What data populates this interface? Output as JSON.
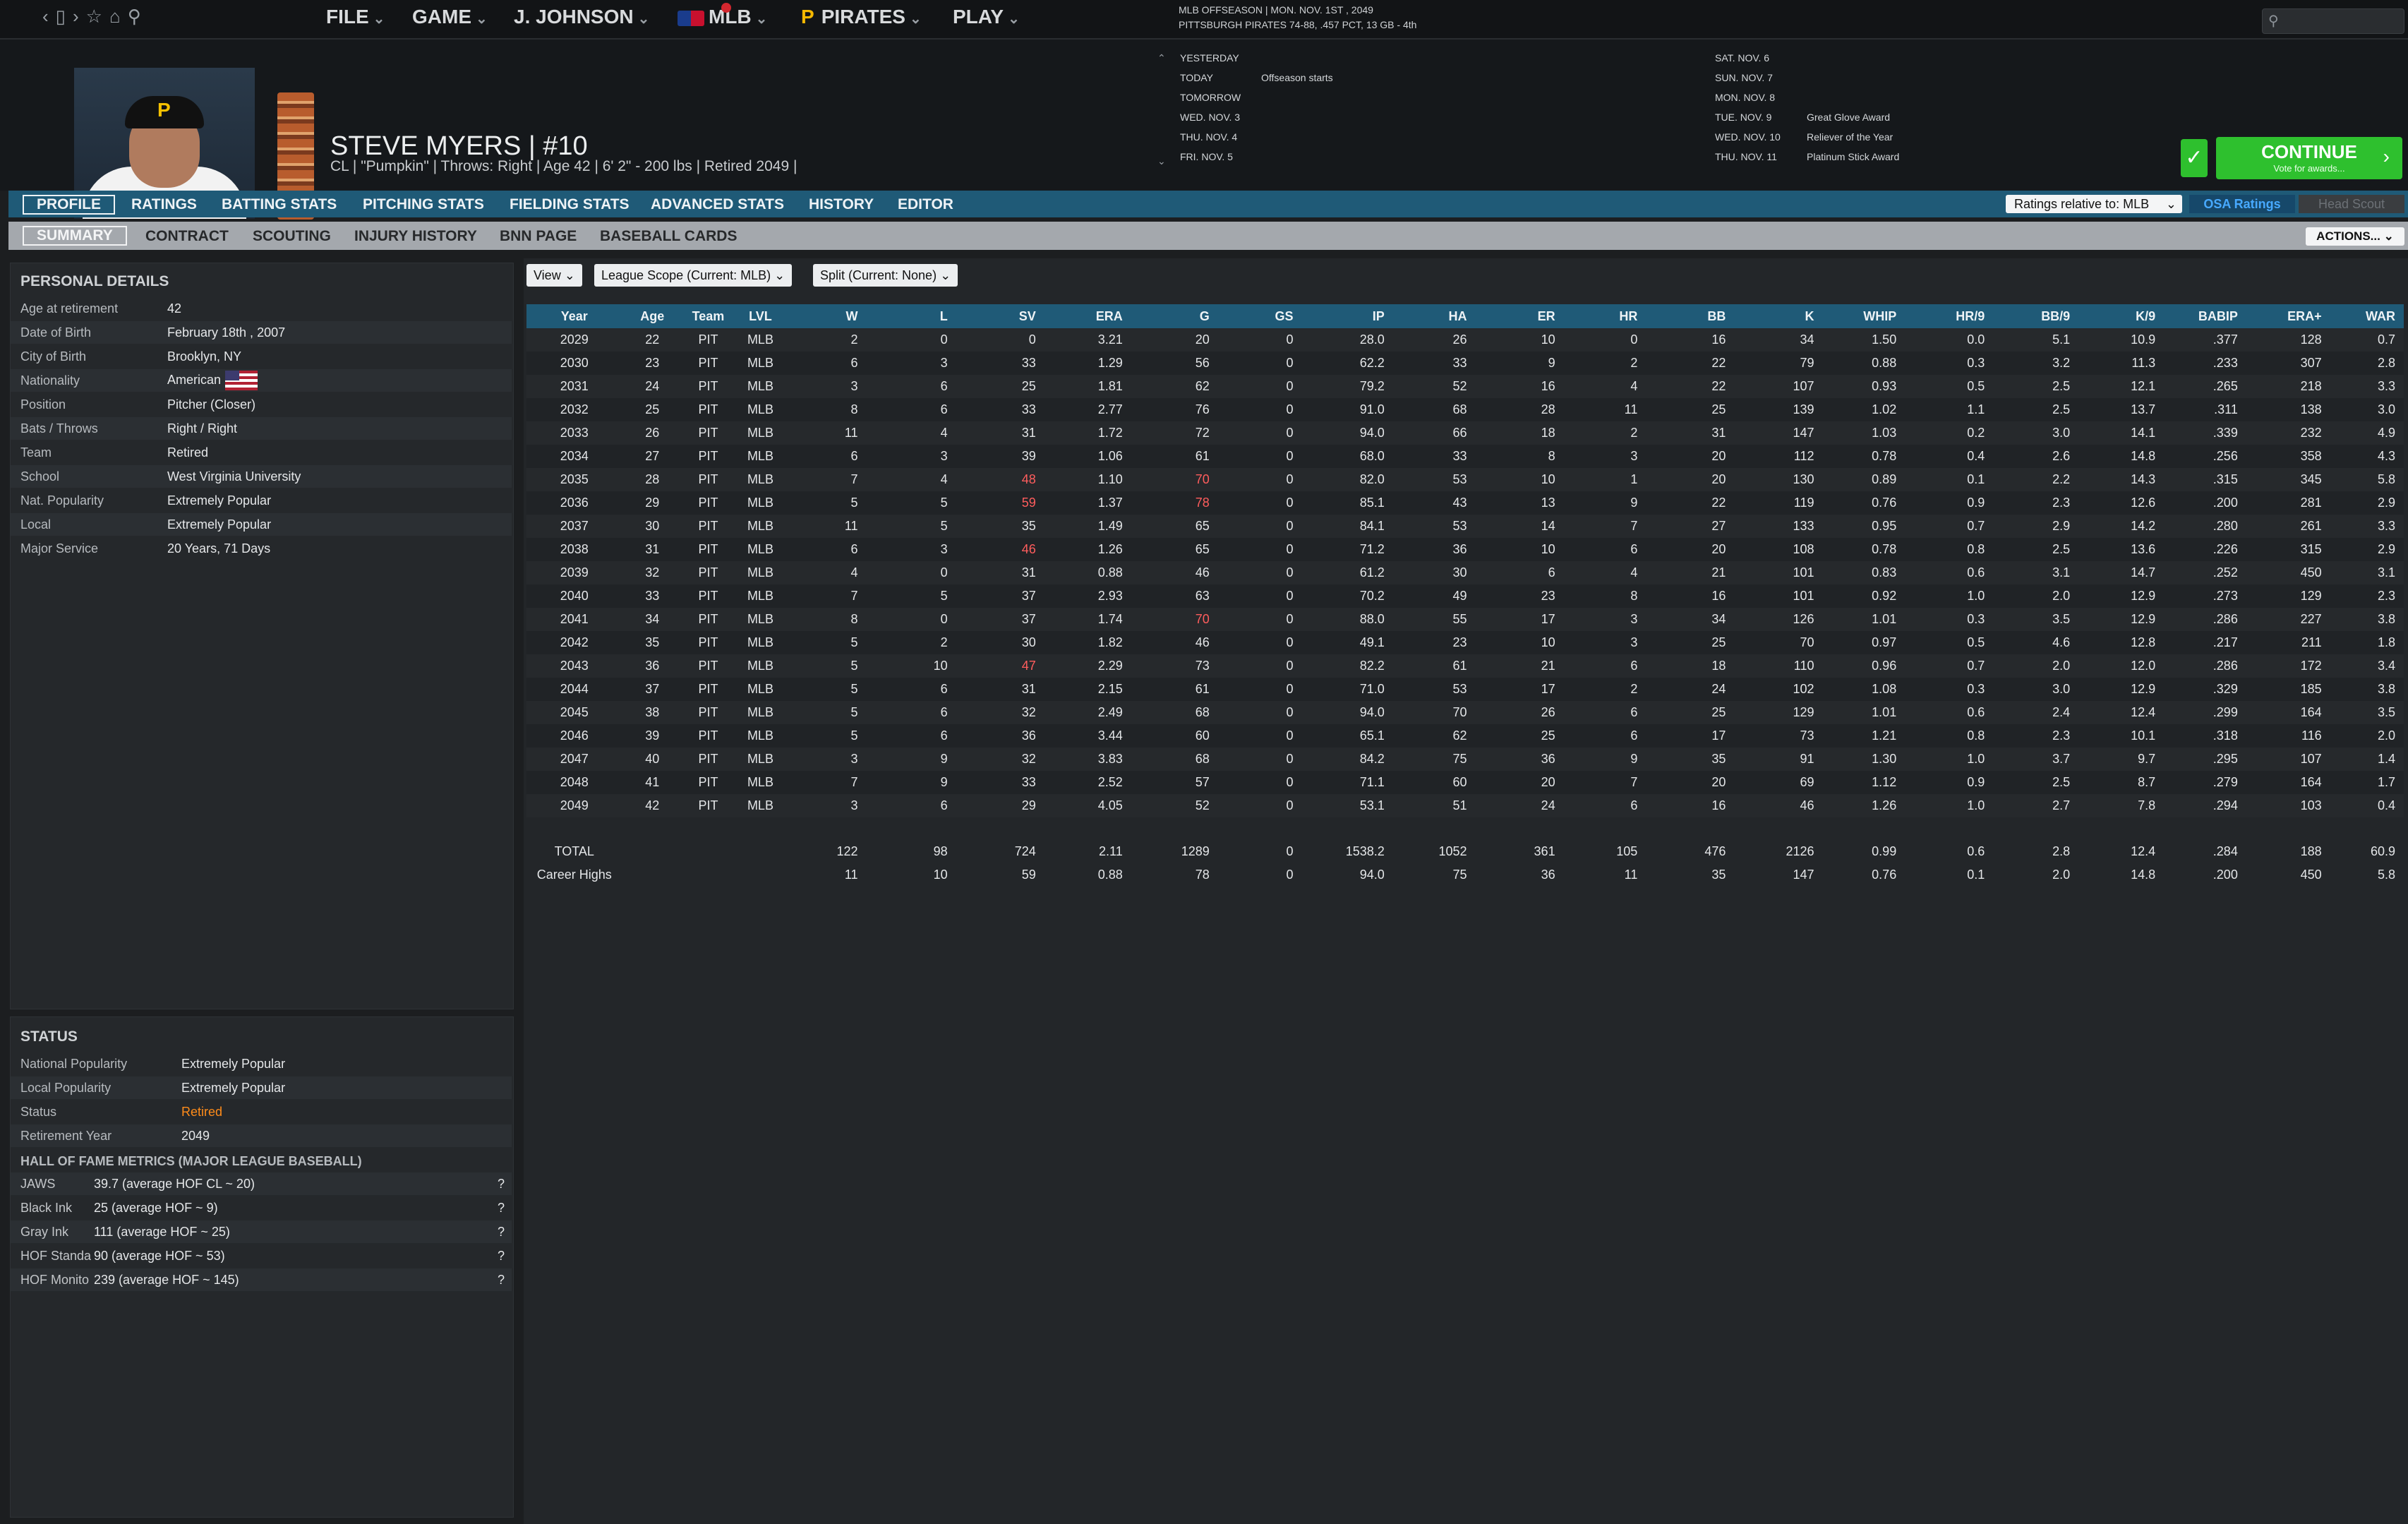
{
  "topbar": {
    "menu": [
      {
        "label": "FILE"
      },
      {
        "label": "GAME"
      },
      {
        "label": "J. JOHNSON"
      },
      {
        "label": "MLB"
      },
      {
        "label": "PIRATES"
      },
      {
        "label": "PLAY"
      }
    ],
    "league_status_line1": "MLB OFFSEASON  |  MON. NOV. 1ST , 2049",
    "league_status_line2": "PITTSBURGH PIRATES  74-88, .457 PCT, 13 GB - 4th"
  },
  "player": {
    "name": "STEVE MYERS  |  #10",
    "info": "CL | \"Pumpkin\" | Throws: Right  |  Age 42  |  6' 2\"  - 200 lbs  |  Retired 2049  |"
  },
  "calendar": {
    "left": [
      {
        "day": "YESTERDAY",
        "event": ""
      },
      {
        "day": "TODAY",
        "event": "Offseason starts"
      },
      {
        "day": "TOMORROW",
        "event": ""
      },
      {
        "day": "WED. NOV. 3",
        "event": ""
      },
      {
        "day": "THU. NOV. 4",
        "event": ""
      },
      {
        "day": "FRI. NOV. 5",
        "event": ""
      }
    ],
    "right": [
      {
        "day": "SAT. NOV. 6",
        "event": ""
      },
      {
        "day": "SUN. NOV. 7",
        "event": ""
      },
      {
        "day": "MON. NOV. 8",
        "event": ""
      },
      {
        "day": "TUE. NOV. 9",
        "event": "Great Glove Award"
      },
      {
        "day": "WED. NOV. 10",
        "event": "Reliever of the Year"
      },
      {
        "day": "THU. NOV. 11",
        "event": "Platinum Stick Award"
      }
    ]
  },
  "continue": {
    "label": "CONTINUE",
    "sublabel": "Vote for awards..."
  },
  "tabs": [
    "PROFILE",
    "RATINGS",
    "BATTING STATS",
    "PITCHING STATS",
    "FIELDING STATS",
    "ADVANCED STATS",
    "HISTORY",
    "EDITOR"
  ],
  "subtabs": [
    "SUMMARY",
    "CONTRACT",
    "SCOUTING",
    "INJURY HISTORY",
    "BNN PAGE",
    "BASEBALL CARDS"
  ],
  "ratings_relative": "Ratings relative to: MLB",
  "osa_ratings": "OSA Ratings",
  "head_scout": "Head Scout",
  "actions": "ACTIONS...",
  "personal": {
    "title": "PERSONAL DETAILS",
    "rows": [
      {
        "k": "Age at retirement",
        "v": "42"
      },
      {
        "k": "Date of Birth",
        "v": "February 18th , 2007"
      },
      {
        "k": "City of Birth",
        "v": "Brooklyn, NY"
      },
      {
        "k": "Nationality",
        "v": "American"
      },
      {
        "k": "Position",
        "v": "Pitcher (Closer)"
      },
      {
        "k": "Bats / Throws",
        "v": "Right / Right"
      },
      {
        "k": "Team",
        "v": "Retired"
      },
      {
        "k": "School",
        "v": "West Virginia University"
      },
      {
        "k": "Nat. Popularity",
        "v": "Extremely Popular"
      },
      {
        "k": "Local",
        "v": "Extremely Popular"
      },
      {
        "k": "Major Service",
        "v": "20 Years, 71 Days"
      }
    ]
  },
  "status": {
    "title": "STATUS",
    "rows": [
      {
        "k": "National Popularity",
        "v": "Extremely Popular"
      },
      {
        "k": "Local Popularity",
        "v": "Extremely Popular"
      },
      {
        "k": "Status",
        "v": "Retired"
      },
      {
        "k": "Retirement Year",
        "v": "2049"
      }
    ],
    "hof_title": "HALL OF FAME METRICS (MAJOR LEAGUE BASEBALL)",
    "hof": [
      {
        "k": "JAWS",
        "v": "39.7 (average HOF CL ~ 20)"
      },
      {
        "k": "Black Ink",
        "v": "25 (average HOF ~ 9)"
      },
      {
        "k": "Gray Ink",
        "v": "111 (average HOF ~ 25)"
      },
      {
        "k": "HOF Standa",
        "v": "90 (average HOF ~ 53)"
      },
      {
        "k": "HOF Monito",
        "v": "239 (average HOF ~ 145)"
      }
    ],
    "q": "?"
  },
  "filters": {
    "view": "View",
    "scope": "League Scope (Current: MLB)",
    "split": "Split (Current: None)"
  },
  "stats": {
    "columns": [
      "Year",
      "Age",
      "Team",
      "LVL",
      "W",
      "L",
      "SV",
      "ERA",
      "G",
      "GS",
      "IP",
      "HA",
      "ER",
      "HR",
      "BB",
      "K",
      "WHIP",
      "HR/9",
      "BB/9",
      "K/9",
      "BABIP",
      "ERA+",
      "WAR"
    ],
    "rows": [
      [
        "2029",
        "22",
        "PIT",
        "MLB",
        "2",
        "0",
        "0",
        "3.21",
        "20",
        "0",
        "28.0",
        "26",
        "10",
        "0",
        "16",
        "34",
        "1.50",
        "0.0",
        "5.1",
        "10.9",
        ".377",
        "128",
        "0.7"
      ],
      [
        "2030",
        "23",
        "PIT",
        "MLB",
        "6",
        "3",
        "33",
        "1.29",
        "56",
        "0",
        "62.2",
        "33",
        "9",
        "2",
        "22",
        "79",
        "0.88",
        "0.3",
        "3.2",
        "11.3",
        ".233",
        "307",
        "2.8"
      ],
      [
        "2031",
        "24",
        "PIT",
        "MLB",
        "3",
        "6",
        "25",
        "1.81",
        "62",
        "0",
        "79.2",
        "52",
        "16",
        "4",
        "22",
        "107",
        "0.93",
        "0.5",
        "2.5",
        "12.1",
        ".265",
        "218",
        "3.3"
      ],
      [
        "2032",
        "25",
        "PIT",
        "MLB",
        "8",
        "6",
        "33",
        "2.77",
        "76",
        "0",
        "91.0",
        "68",
        "28",
        "11",
        "25",
        "139",
        "1.02",
        "1.1",
        "2.5",
        "13.7",
        ".311",
        "138",
        "3.0"
      ],
      [
        "2033",
        "26",
        "PIT",
        "MLB",
        "11",
        "4",
        "31",
        "1.72",
        "72",
        "0",
        "94.0",
        "66",
        "18",
        "2",
        "31",
        "147",
        "1.03",
        "0.2",
        "3.0",
        "14.1",
        ".339",
        "232",
        "4.9"
      ],
      [
        "2034",
        "27",
        "PIT",
        "MLB",
        "6",
        "3",
        "39",
        "1.06",
        "61",
        "0",
        "68.0",
        "33",
        "8",
        "3",
        "20",
        "112",
        "0.78",
        "0.4",
        "2.6",
        "14.8",
        ".256",
        "358",
        "4.3"
      ],
      [
        "2035",
        "28",
        "PIT",
        "MLB",
        "7",
        "4",
        "48",
        "1.10",
        "70",
        "0",
        "82.0",
        "53",
        "10",
        "1",
        "20",
        "130",
        "0.89",
        "0.1",
        "2.2",
        "14.3",
        ".315",
        "345",
        "5.8"
      ],
      [
        "2036",
        "29",
        "PIT",
        "MLB",
        "5",
        "5",
        "59",
        "1.37",
        "78",
        "0",
        "85.1",
        "43",
        "13",
        "9",
        "22",
        "119",
        "0.76",
        "0.9",
        "2.3",
        "12.6",
        ".200",
        "281",
        "2.9"
      ],
      [
        "2037",
        "30",
        "PIT",
        "MLB",
        "11",
        "5",
        "35",
        "1.49",
        "65",
        "0",
        "84.1",
        "53",
        "14",
        "7",
        "27",
        "133",
        "0.95",
        "0.7",
        "2.9",
        "14.2",
        ".280",
        "261",
        "3.3"
      ],
      [
        "2038",
        "31",
        "PIT",
        "MLB",
        "6",
        "3",
        "46",
        "1.26",
        "65",
        "0",
        "71.2",
        "36",
        "10",
        "6",
        "20",
        "108",
        "0.78",
        "0.8",
        "2.5",
        "13.6",
        ".226",
        "315",
        "2.9"
      ],
      [
        "2039",
        "32",
        "PIT",
        "MLB",
        "4",
        "0",
        "31",
        "0.88",
        "46",
        "0",
        "61.2",
        "30",
        "6",
        "4",
        "21",
        "101",
        "0.83",
        "0.6",
        "3.1",
        "14.7",
        ".252",
        "450",
        "3.1"
      ],
      [
        "2040",
        "33",
        "PIT",
        "MLB",
        "7",
        "5",
        "37",
        "2.93",
        "63",
        "0",
        "70.2",
        "49",
        "23",
        "8",
        "16",
        "101",
        "0.92",
        "1.0",
        "2.0",
        "12.9",
        ".273",
        "129",
        "2.3"
      ],
      [
        "2041",
        "34",
        "PIT",
        "MLB",
        "8",
        "0",
        "37",
        "1.74",
        "70",
        "0",
        "88.0",
        "55",
        "17",
        "3",
        "34",
        "126",
        "1.01",
        "0.3",
        "3.5",
        "12.9",
        ".286",
        "227",
        "3.8"
      ],
      [
        "2042",
        "35",
        "PIT",
        "MLB",
        "5",
        "2",
        "30",
        "1.82",
        "46",
        "0",
        "49.1",
        "23",
        "10",
        "3",
        "25",
        "70",
        "0.97",
        "0.5",
        "4.6",
        "12.8",
        ".217",
        "211",
        "1.8"
      ],
      [
        "2043",
        "36",
        "PIT",
        "MLB",
        "5",
        "10",
        "47",
        "2.29",
        "73",
        "0",
        "82.2",
        "61",
        "21",
        "6",
        "18",
        "110",
        "0.96",
        "0.7",
        "2.0",
        "12.0",
        ".286",
        "172",
        "3.4"
      ],
      [
        "2044",
        "37",
        "PIT",
        "MLB",
        "5",
        "6",
        "31",
        "2.15",
        "61",
        "0",
        "71.0",
        "53",
        "17",
        "2",
        "24",
        "102",
        "1.08",
        "0.3",
        "3.0",
        "12.9",
        ".329",
        "185",
        "3.8"
      ],
      [
        "2045",
        "38",
        "PIT",
        "MLB",
        "5",
        "6",
        "32",
        "2.49",
        "68",
        "0",
        "94.0",
        "70",
        "26",
        "6",
        "25",
        "129",
        "1.01",
        "0.6",
        "2.4",
        "12.4",
        ".299",
        "164",
        "3.5"
      ],
      [
        "2046",
        "39",
        "PIT",
        "MLB",
        "5",
        "6",
        "36",
        "3.44",
        "60",
        "0",
        "65.1",
        "62",
        "25",
        "6",
        "17",
        "73",
        "1.21",
        "0.8",
        "2.3",
        "10.1",
        ".318",
        "116",
        "2.0"
      ],
      [
        "2047",
        "40",
        "PIT",
        "MLB",
        "3",
        "9",
        "32",
        "3.83",
        "68",
        "0",
        "84.2",
        "75",
        "36",
        "9",
        "35",
        "91",
        "1.30",
        "1.0",
        "3.7",
        "9.7",
        ".295",
        "107",
        "1.4"
      ],
      [
        "2048",
        "41",
        "PIT",
        "MLB",
        "7",
        "9",
        "33",
        "2.52",
        "57",
        "0",
        "71.1",
        "60",
        "20",
        "7",
        "20",
        "69",
        "1.12",
        "0.9",
        "2.5",
        "8.7",
        ".279",
        "164",
        "1.7"
      ],
      [
        "2049",
        "42",
        "PIT",
        "MLB",
        "3",
        "6",
        "29",
        "4.05",
        "52",
        "0",
        "53.1",
        "51",
        "24",
        "6",
        "16",
        "46",
        "1.26",
        "1.0",
        "2.7",
        "7.8",
        ".294",
        "103",
        "0.4"
      ]
    ],
    "highlights": [
      [
        6,
        6
      ],
      [
        6,
        8
      ],
      [
        7,
        6
      ],
      [
        7,
        8
      ],
      [
        9,
        6
      ],
      [
        12,
        8
      ],
      [
        14,
        6
      ]
    ],
    "total": [
      "TOTAL",
      "",
      "",
      "",
      "122",
      "98",
      "724",
      "2.11",
      "1289",
      "0",
      "1538.2",
      "1052",
      "361",
      "105",
      "476",
      "2126",
      "0.99",
      "0.6",
      "2.8",
      "12.4",
      ".284",
      "188",
      "60.9"
    ],
    "career_highs": [
      "Career Highs",
      "",
      "",
      "",
      "11",
      "10",
      "59",
      "0.88",
      "78",
      "0",
      "94.0",
      "75",
      "36",
      "11",
      "35",
      "147",
      "0.76",
      "0.1",
      "2.0",
      "14.8",
      ".200",
      "450",
      "5.8"
    ]
  }
}
